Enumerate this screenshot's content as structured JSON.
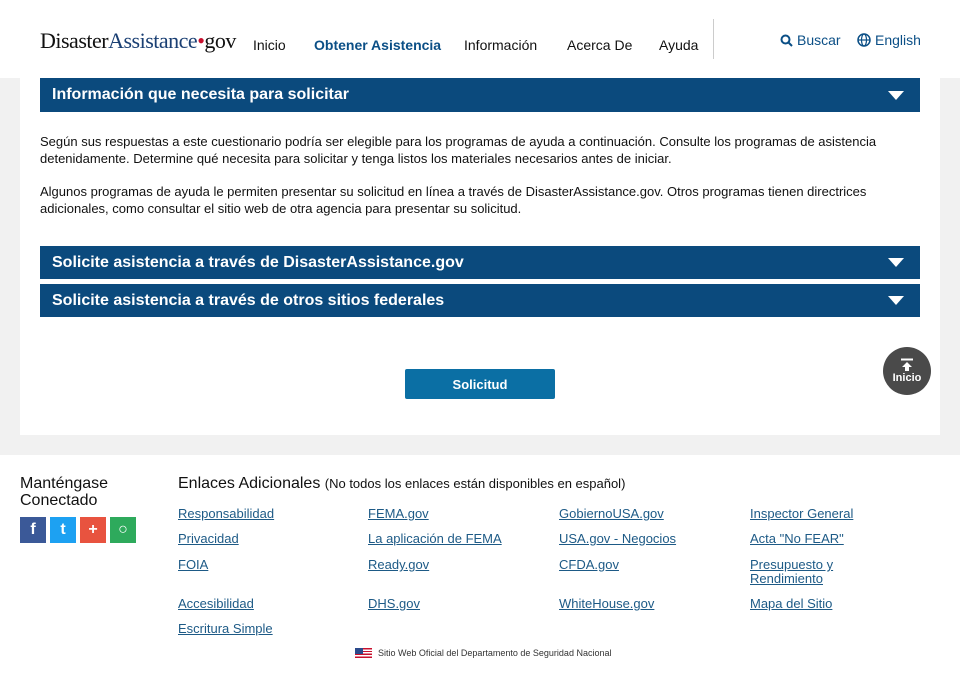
{
  "header": {
    "logo": {
      "part1": "Disaster",
      "part2": "Assistance",
      "dot": "•",
      "part3": "gov"
    },
    "nav": [
      "Inicio",
      "Obtener Asistencia",
      "Información",
      "Acerca De",
      "Ayuda"
    ],
    "search": "Buscar",
    "language": "English"
  },
  "main": {
    "accordion1": "Información que necesita para solicitar",
    "para1": "Según sus respuestas a este cuestionario podría ser elegible para los programas de ayuda a continuación. Consulte los programas de asistencia detenidamente. Determine qué necesita para solicitar y tenga listos los materiales necesarios antes de iniciar.",
    "para2": "Algunos programas de ayuda le permiten presentar su solicitud en línea a través de DisasterAssistance.gov. Otros programas tienen directrices adicionales, como consultar el sitio web de otra agencia para presentar su solicitud.",
    "accordion2": "Solicite asistencia a través de DisasterAssistance.gov",
    "accordion3": "Solicite asistencia a través de otros sitios federales",
    "apply_button": "Solicitud",
    "back_to_top": "Inicio"
  },
  "footer": {
    "connected": "Manténgase Conectado",
    "links_title": "Enlaces Adicionales",
    "links_note": "(No todos los enlaces están disponibles en español)",
    "links": [
      [
        "Responsabilidad",
        "Privacidad",
        "FOIA",
        "Accesibilidad",
        "Escritura Simple"
      ],
      [
        "FEMA.gov",
        "La aplicación de FEMA",
        "Ready.gov",
        "DHS.gov"
      ],
      [
        "GobiernoUSA.gov",
        "USA.gov - Negocios",
        "CFDA.gov",
        "WhiteHouse.gov"
      ],
      [
        "Inspector General",
        "Acta \"No FEAR\"",
        "Presupuesto y Rendimiento",
        "Mapa del Sitio"
      ]
    ],
    "official": "Sitio Web Oficial del Departamento de Seguridad Nacional"
  },
  "colors": {
    "accordion": "#0b4a7d",
    "button": "#0b6fa4",
    "link": "#1d5a86"
  }
}
